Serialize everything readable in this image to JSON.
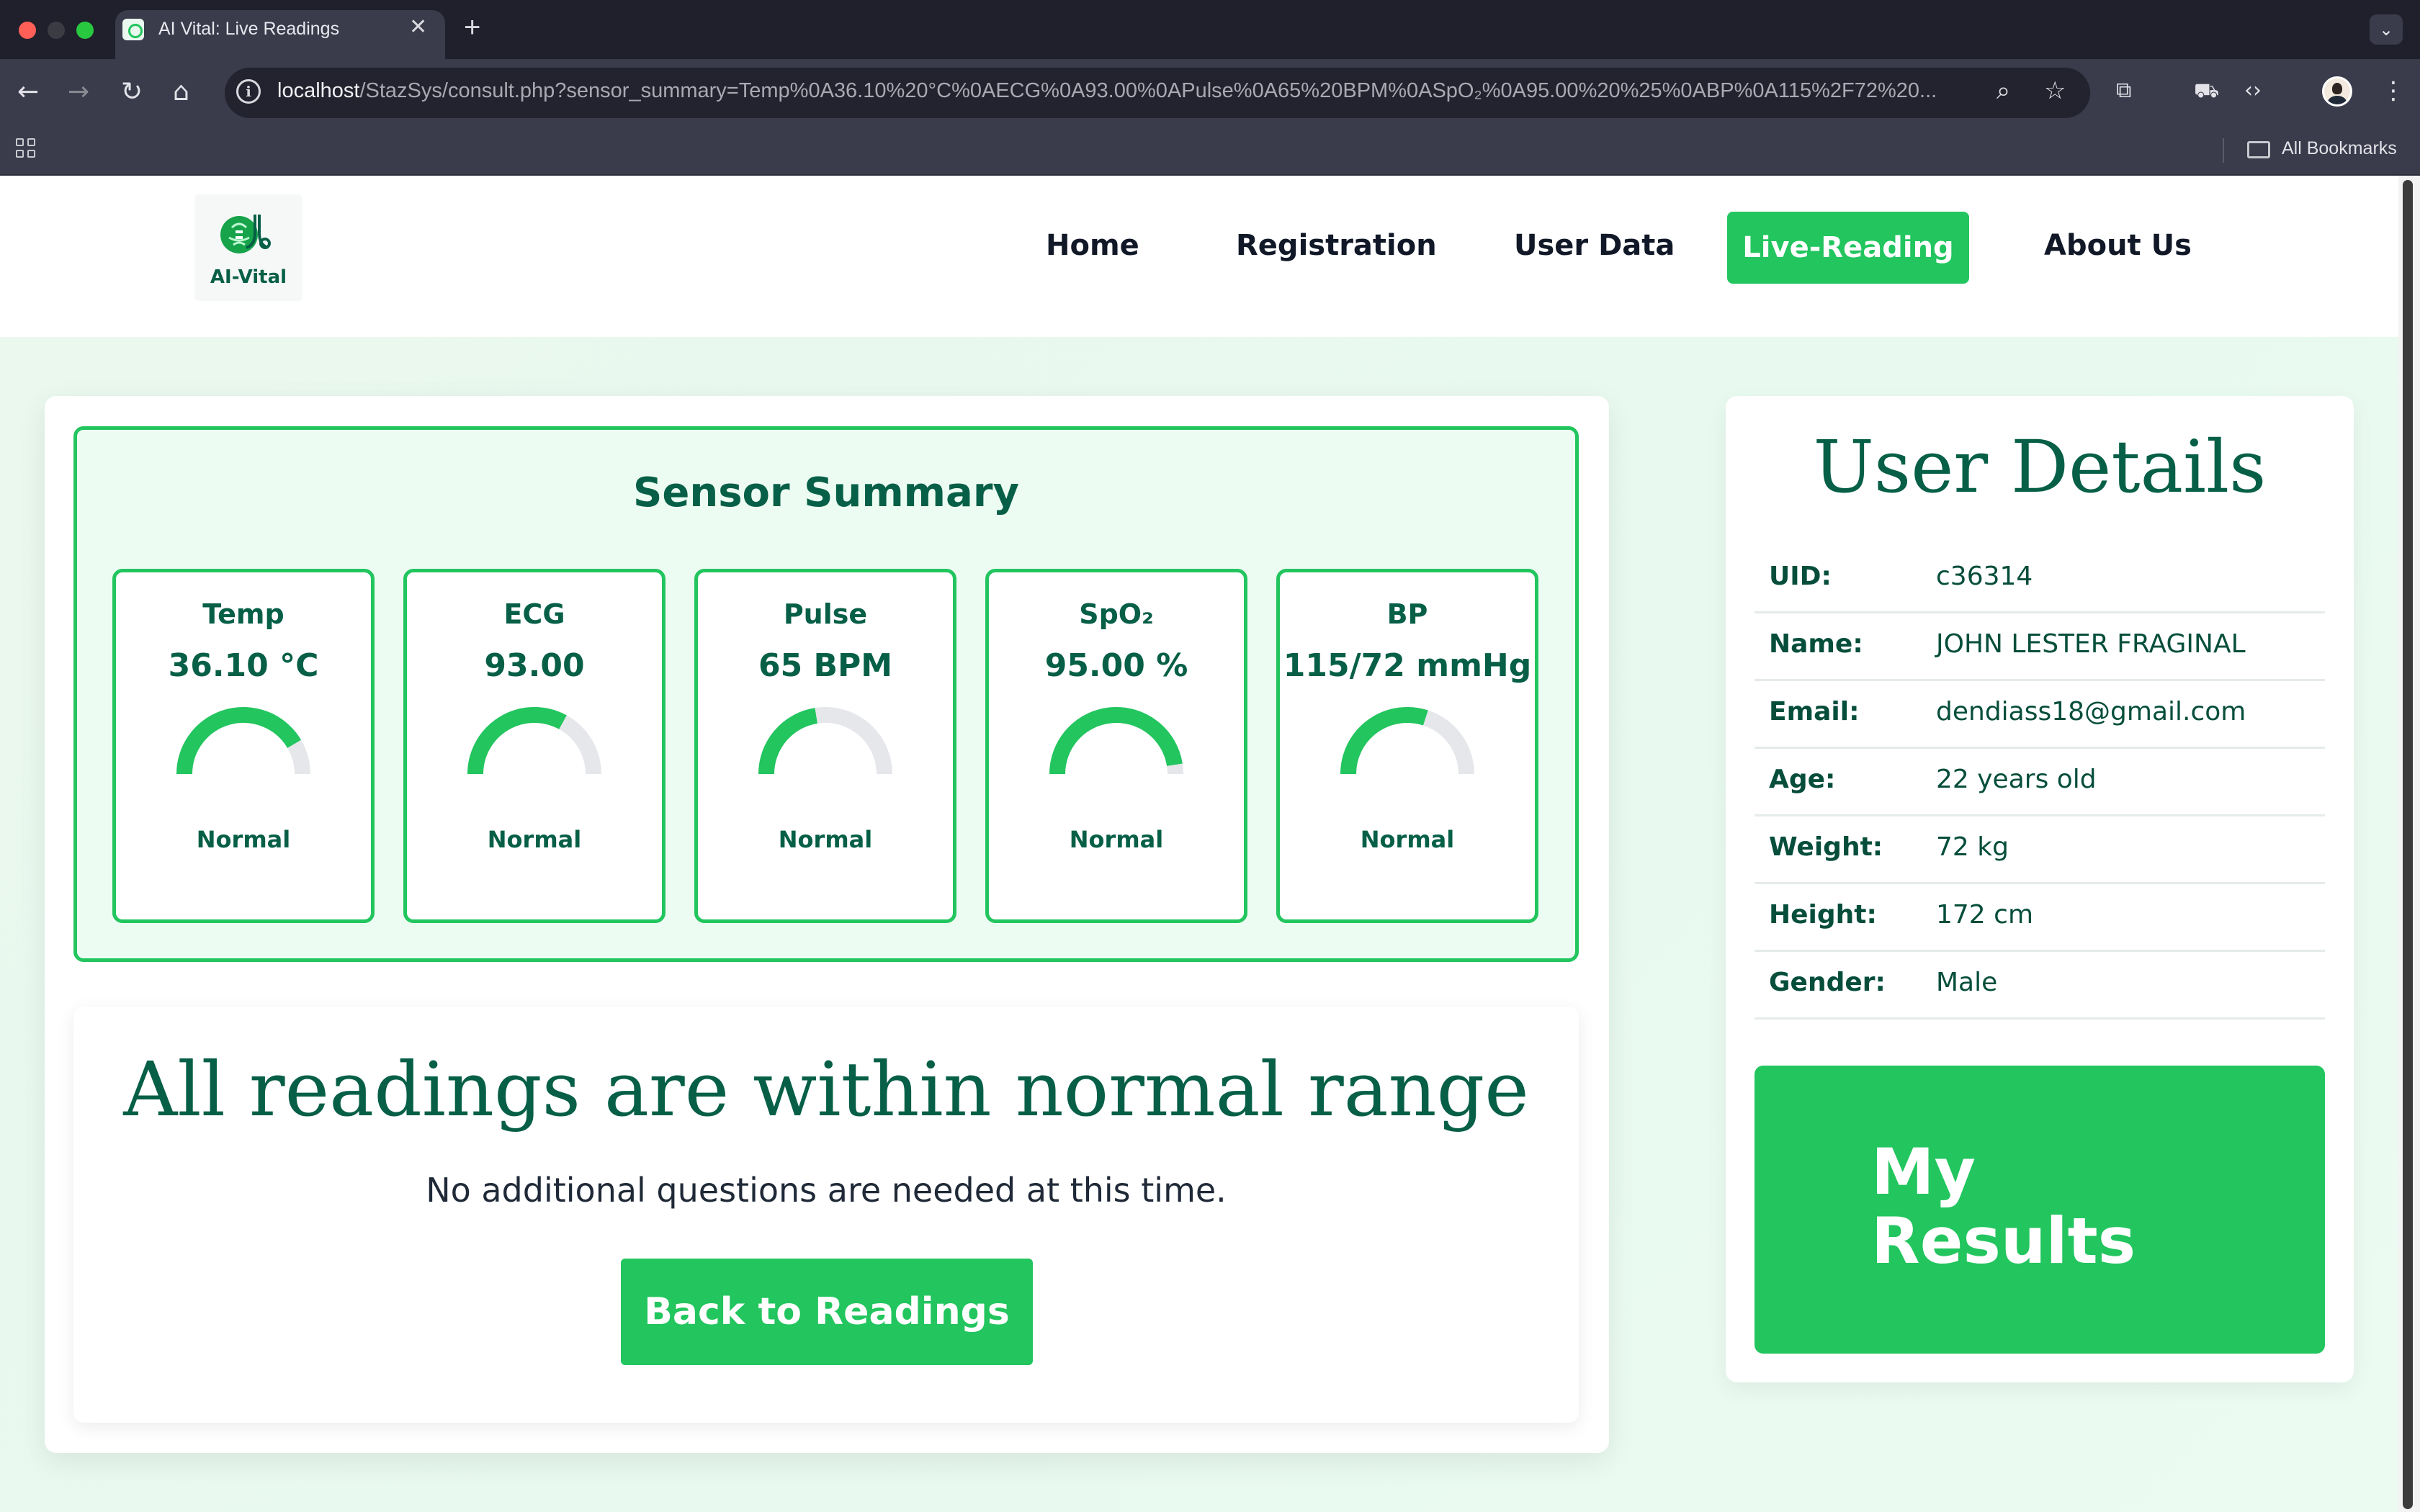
{
  "browser": {
    "tab_title": "AI Vital: Live Readings",
    "tab_close": "✕",
    "new_tab": "+",
    "url_host": "localhost",
    "url_rest": "/StazSys/consult.php?sensor_summary=Temp%0A36.10%20°C%0AECG%0A93.00%0APulse%0A65%20BPM%0ASpO₂%0A95.00%20%25%0ABP%0A115%2F72%20...",
    "bookmarks_label": "All Bookmarks",
    "icons": [
      "back-icon",
      "forward-icon",
      "reload-icon",
      "home-icon",
      "info-icon",
      "zoom-icon",
      "star-icon",
      "extensions-icon",
      "incognito-icon",
      "code-icon",
      "profile-avatar",
      "more-icon",
      "apps-icon",
      "folder-icon"
    ]
  },
  "site": {
    "logo_text": "AI-Vital",
    "nav": {
      "home": "Home",
      "registration": "Registration",
      "user_data": "User Data",
      "live_reading": "Live-Reading",
      "about": "About Us"
    },
    "accent_color": "#22c55e",
    "text_color": "#065f46"
  },
  "summary": {
    "title": "Sensor Summary",
    "sensors": [
      {
        "label": "Temp",
        "value": "36.10 °C",
        "status": "Normal",
        "gauge_fraction": 0.83
      },
      {
        "label": "ECG",
        "value": "93.00",
        "status": "Normal",
        "gauge_fraction": 0.66
      },
      {
        "label": "Pulse",
        "value": "65 BPM",
        "status": "Normal",
        "gauge_fraction": 0.45
      },
      {
        "label": "SpO₂",
        "value": "95.00 %",
        "status": "Normal",
        "gauge_fraction": 0.95
      },
      {
        "label": "BP",
        "value": "115/72 mmHg",
        "status": "Normal",
        "gauge_fraction": 0.6
      }
    ]
  },
  "message": {
    "title": "All readings are within normal range",
    "subtitle": "No additional questions are needed at this time.",
    "button": "Back to Readings"
  },
  "user": {
    "title": "User Details",
    "rows": [
      {
        "key": "UID:",
        "value": "c36314"
      },
      {
        "key": "Name:",
        "value": "JOHN LESTER FRAGINAL"
      },
      {
        "key": "Email:",
        "value": "dendiass18@gmail.com"
      },
      {
        "key": "Age:",
        "value": "22 years old"
      },
      {
        "key": "Weight:",
        "value": "72 kg"
      },
      {
        "key": "Height:",
        "value": "172 cm"
      },
      {
        "key": "Gender:",
        "value": "Male"
      }
    ],
    "results_button": "My Results"
  }
}
